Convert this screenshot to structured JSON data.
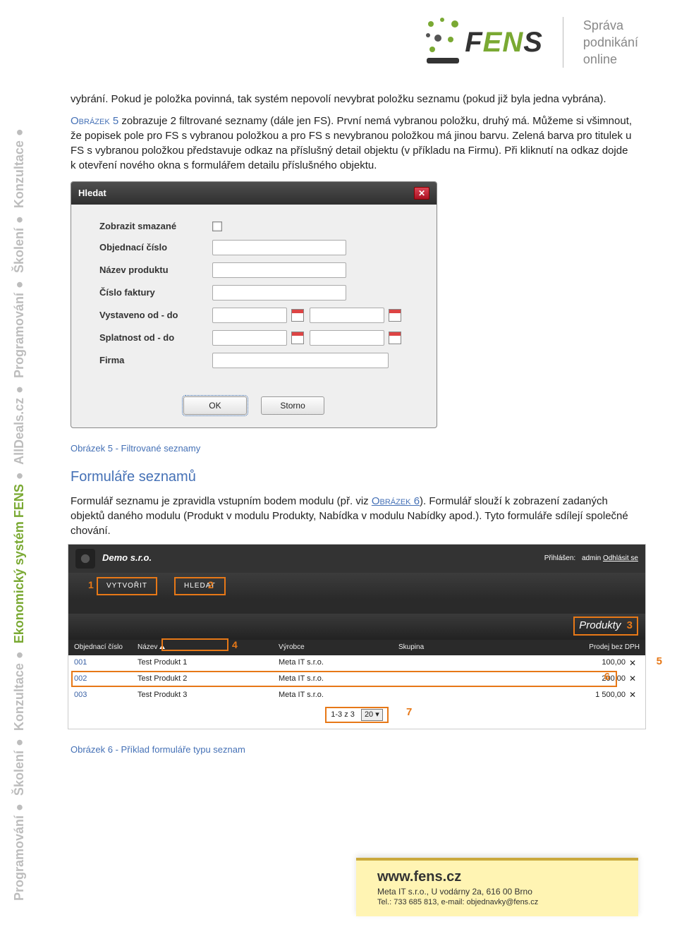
{
  "sidebar": {
    "segments": [
      {
        "text": "Programování",
        "hl": false
      },
      {
        "text": "Školení",
        "hl": false
      },
      {
        "text": "Konzultace",
        "hl": false
      },
      {
        "text": "Ekonomický systém FENS",
        "hl": true
      },
      {
        "text": "AllDeals.cz",
        "hl": false
      },
      {
        "text": "Programování",
        "hl": false
      },
      {
        "text": "Školení",
        "hl": false
      },
      {
        "text": "Konzultace",
        "hl": false
      }
    ]
  },
  "header": {
    "brand_f": "F",
    "brand_en": "EN",
    "brand_s": "S",
    "tagline_l1": "Správa",
    "tagline_l2": "podnikání",
    "tagline_l3": "online"
  },
  "para1_a": "vybrání. Pokud je položka povinná, tak systém nepovolí nevybrat položku seznamu (pokud již byla jedna vybrána).",
  "para2_ref": "Obrázek 5",
  "para2_b": " zobrazuje 2 filtrované seznamy (dále jen FS). První nemá vybranou položku, druhý má. Můžeme si všimnout, že popisek pole pro FS s vybranou položkou a pro FS s nevybranou položkou má jinou barvu. Zelená barva pro titulek u FS s vybranou položkou představuje odkaz na příslušný detail objektu (v příkladu na Firmu). Při kliknutí na odkaz dojde k otevření nového okna s formulářem detailu příslušného objektu.",
  "dialog": {
    "title": "Hledat",
    "rows": {
      "zobrazit": "Zobrazit smazané",
      "objednaci": "Objednací číslo",
      "nazev": "Název produktu",
      "cislo_fak": "Číslo faktury",
      "vystaveno": "Vystaveno od - do",
      "splatnost": "Splatnost od - do",
      "firma": "Firma"
    },
    "ok": "OK",
    "storno": "Storno"
  },
  "caption1": "Obrázek 5 - Filtrované seznamy",
  "section_h": "Formuláře seznamů",
  "para3_a": "Formulář seznamu je zpravidla vstupním bodem modulu (př. viz ",
  "para3_ref": "Obrázek 6",
  "para3_b": "). Formulář slouží k zobrazení zadaných objektů daného modulu (Produkt v modulu Produkty, Nabídka v modulu Nabídky apod.). Tyto formuláře sdílejí společné chování.",
  "app": {
    "company": "Demo s.r.o.",
    "login_prefix": "Přihlášen:",
    "login_user": "admin",
    "logout": "Odhlásit se",
    "btn_create": "VYTVOŘIT",
    "btn_search": "HLEDAT",
    "title": "Produkty",
    "cols": {
      "obj": "Objednací číslo",
      "nazev": "Název",
      "vyrobce": "Výrobce",
      "skupina": "Skupina",
      "prodej": "Prodej bez DPH"
    },
    "rows": [
      {
        "obj": "001",
        "nazev": "Test Produkt 1",
        "vyrobce": "Meta IT s.r.o.",
        "skupina": "",
        "prodej": "100,00"
      },
      {
        "obj": "002",
        "nazev": "Test Produkt 2",
        "vyrobce": "Meta IT s.r.o.",
        "skupina": "",
        "prodej": "200,00"
      },
      {
        "obj": "003",
        "nazev": "Test Produkt 3",
        "vyrobce": "Meta IT s.r.o.",
        "skupina": "",
        "prodej": "1 500,00"
      }
    ],
    "pager_text": "1-3 z 3",
    "pager_sel": "20",
    "callouts": {
      "c1": "1",
      "c2": "2",
      "c3": "3",
      "c4": "4",
      "c5": "5",
      "c6": "6",
      "c7": "7"
    }
  },
  "caption2": "Obrázek 6 -  Příklad formuláře typu seznam",
  "footer": {
    "site": "www.fens.cz",
    "line1": "Meta IT s.r.o., U vodárny 2a, 616 00 Brno",
    "line2": "Tel.: 733 685 813, e-mail: objednavky@fens.cz"
  }
}
